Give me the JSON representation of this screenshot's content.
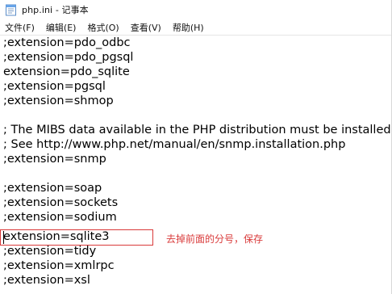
{
  "window": {
    "title": "php.ini - 记事本",
    "icon_name": "notepad-icon"
  },
  "menu": {
    "items": [
      "文件(F)",
      "编辑(E)",
      "格式(O)",
      "查看(V)",
      "帮助(H)"
    ]
  },
  "editor": {
    "lines": [
      ";extension=pdo_odbc",
      ";extension=pdo_pgsql",
      "extension=pdo_sqlite",
      ";extension=pgsql",
      ";extension=shmop",
      "",
      "; The MIBS data available in the PHP distribution must be installed.",
      "; See http://www.php.net/manual/en/snmp.installation.php",
      ";extension=snmp",
      "",
      ";extension=soap",
      ";extension=sockets",
      ";extension=sodium",
      "extension=sqlite3",
      ";extension=tidy",
      ";extension=xmlrpc",
      ";extension=xsl"
    ],
    "annotation": "去掉前面的分号，保存",
    "highlight_color": "#d93a3a"
  }
}
